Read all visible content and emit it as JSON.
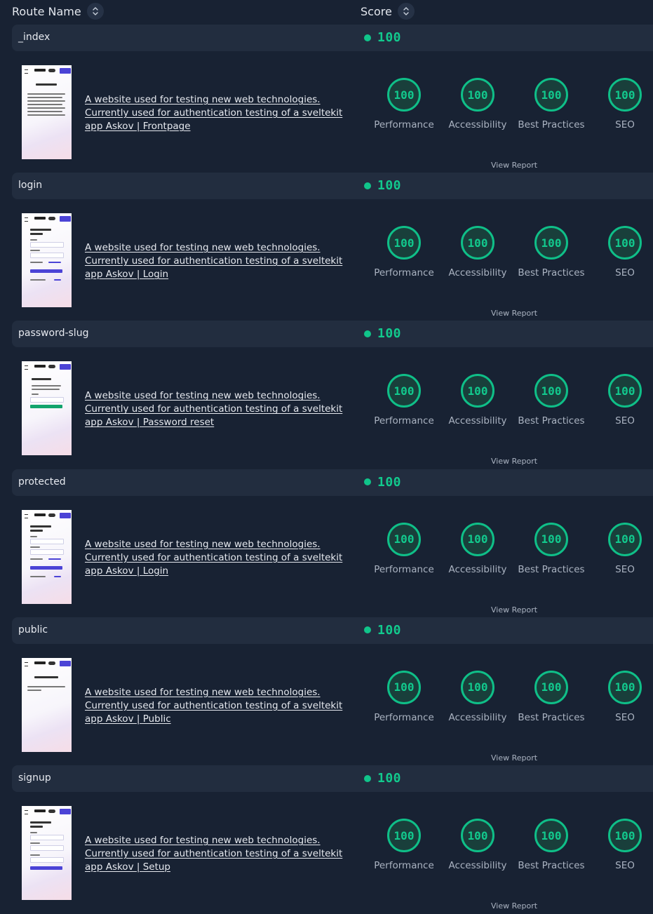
{
  "header": {
    "route_name_label": "Route Name",
    "score_label": "Score",
    "sort_icon": "chevron-up-down-icon"
  },
  "colors": {
    "background": "#182233",
    "route_bar": "#222d3f",
    "score_green": "#12c98d"
  },
  "gauge_labels": [
    "Performance",
    "Accessibility",
    "Best Practices",
    "SEO"
  ],
  "view_report_label": "View Report",
  "routes": [
    {
      "name": "_index",
      "average": "100",
      "description": "A website used for testing new web technologies. Currently used for authentication testing of a sveltekit app Askov | Frontpage",
      "thumbnail": "welcome",
      "scores": [
        "100",
        "100",
        "100",
        "100"
      ]
    },
    {
      "name": "login",
      "average": "100",
      "description": "A website used for testing new web technologies. Currently used for authentication testing of a sveltekit app Askov | Login",
      "thumbnail": "login",
      "scores": [
        "100",
        "100",
        "100",
        "100"
      ]
    },
    {
      "name": "password-slug",
      "average": "100",
      "description": "A website used for testing new web technologies. Currently used for authentication testing of a sveltekit app Askov | Password reset",
      "thumbnail": "reset",
      "scores": [
        "100",
        "100",
        "100",
        "100"
      ]
    },
    {
      "name": "protected",
      "average": "100",
      "description": "A website used for testing new web technologies. Currently used for authentication testing of a sveltekit app Askov | Login",
      "thumbnail": "login",
      "scores": [
        "100",
        "100",
        "100",
        "100"
      ]
    },
    {
      "name": "public",
      "average": "100",
      "description": "A website used for testing new web technologies. Currently used for authentication testing of a sveltekit app Askov | Public",
      "thumbnail": "public",
      "scores": [
        "100",
        "100",
        "100",
        "100"
      ]
    },
    {
      "name": "signup",
      "average": "100",
      "description": "A website used for testing new web technologies. Currently used for authentication testing of a sveltekit app Askov | Setup",
      "thumbnail": "signup",
      "scores": [
        "100",
        "100",
        "100",
        "100"
      ]
    }
  ]
}
